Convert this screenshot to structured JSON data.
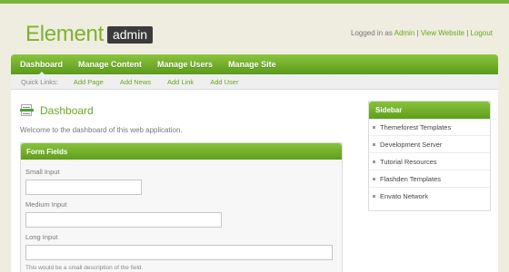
{
  "brand": {
    "name": "Element",
    "badge": "admin"
  },
  "user_bar": {
    "prefix": "Logged in as ",
    "user": "Admin",
    "sep1": " | ",
    "view_site": "View Website",
    "sep2": " | ",
    "logout": "Logout"
  },
  "nav": {
    "items": [
      {
        "label": "Dashboard"
      },
      {
        "label": "Manage Content"
      },
      {
        "label": "Manage Users"
      },
      {
        "label": "Manage Site"
      }
    ]
  },
  "quick_links": {
    "label": "Quick Links:",
    "items": [
      {
        "label": "Add Page"
      },
      {
        "label": "Add News"
      },
      {
        "label": "Add Link"
      },
      {
        "label": "Add User"
      }
    ]
  },
  "main": {
    "title": "Dashboard",
    "title_icon": "document-icon",
    "welcome": "Welcome to the dashboard of this web application.",
    "form": {
      "title": "Form Fields",
      "fields": [
        {
          "label": "Small Input",
          "value": ""
        },
        {
          "label": "Medium Input",
          "value": ""
        },
        {
          "label": "Long Input",
          "value": ""
        }
      ],
      "description": "This would be a small description of the field."
    }
  },
  "sidebar": {
    "title": "Sidebar",
    "items": [
      {
        "label": "Themeforest Templates"
      },
      {
        "label": "Development Server"
      },
      {
        "label": "Tutorial Resources"
      },
      {
        "label": "Flashden Templates"
      },
      {
        "label": "Envato Network"
      }
    ]
  },
  "colors": {
    "accent": "#6aa823",
    "background": "#efece0",
    "nav_top": "#8cc53e",
    "nav_bottom": "#5b9a1b"
  }
}
